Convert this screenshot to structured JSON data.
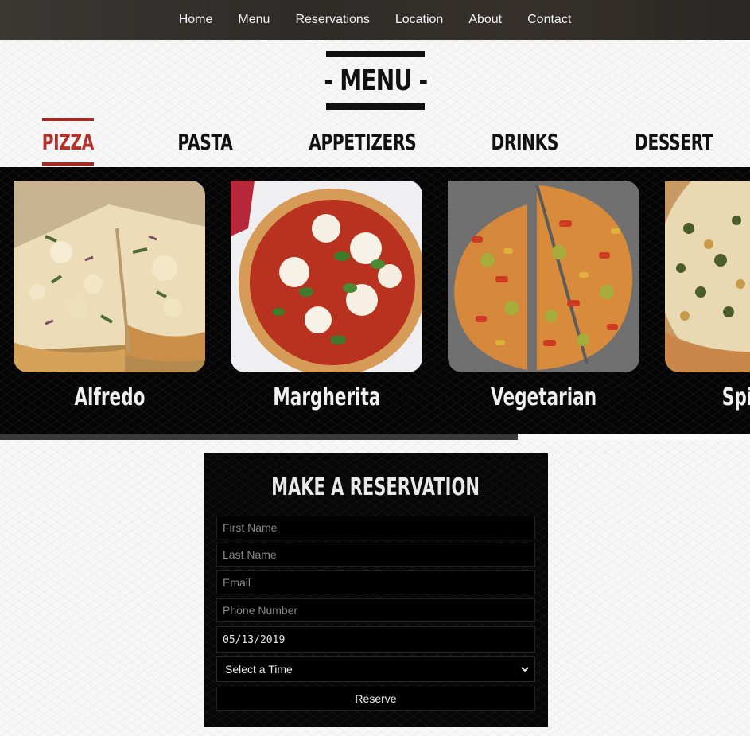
{
  "nav": {
    "items": [
      "Home",
      "Menu",
      "Reservations",
      "Location",
      "About",
      "Contact"
    ]
  },
  "menu": {
    "title": "- MENU -",
    "tabs": [
      "PIZZA",
      "PASTA",
      "APPETIZERS",
      "DRINKS",
      "DESSERT"
    ],
    "active_tab": "PIZZA",
    "items": [
      "Alfredo",
      "Margherita",
      "Vegetarian",
      "Spinach"
    ],
    "carousel_scroll_fraction": 0.69
  },
  "reservation": {
    "title": "MAKE A RESERVATION",
    "first_name_placeholder": "First Name",
    "last_name_placeholder": "Last Name",
    "email_placeholder": "Email",
    "phone_placeholder": "Phone Number",
    "date_value": "05/13/2019",
    "time_select": "Select a Time",
    "submit_label": "Reserve"
  },
  "colors": {
    "accent": "#a52a24",
    "nav_bg": "#322e2a",
    "panel_bg": "#070707"
  }
}
